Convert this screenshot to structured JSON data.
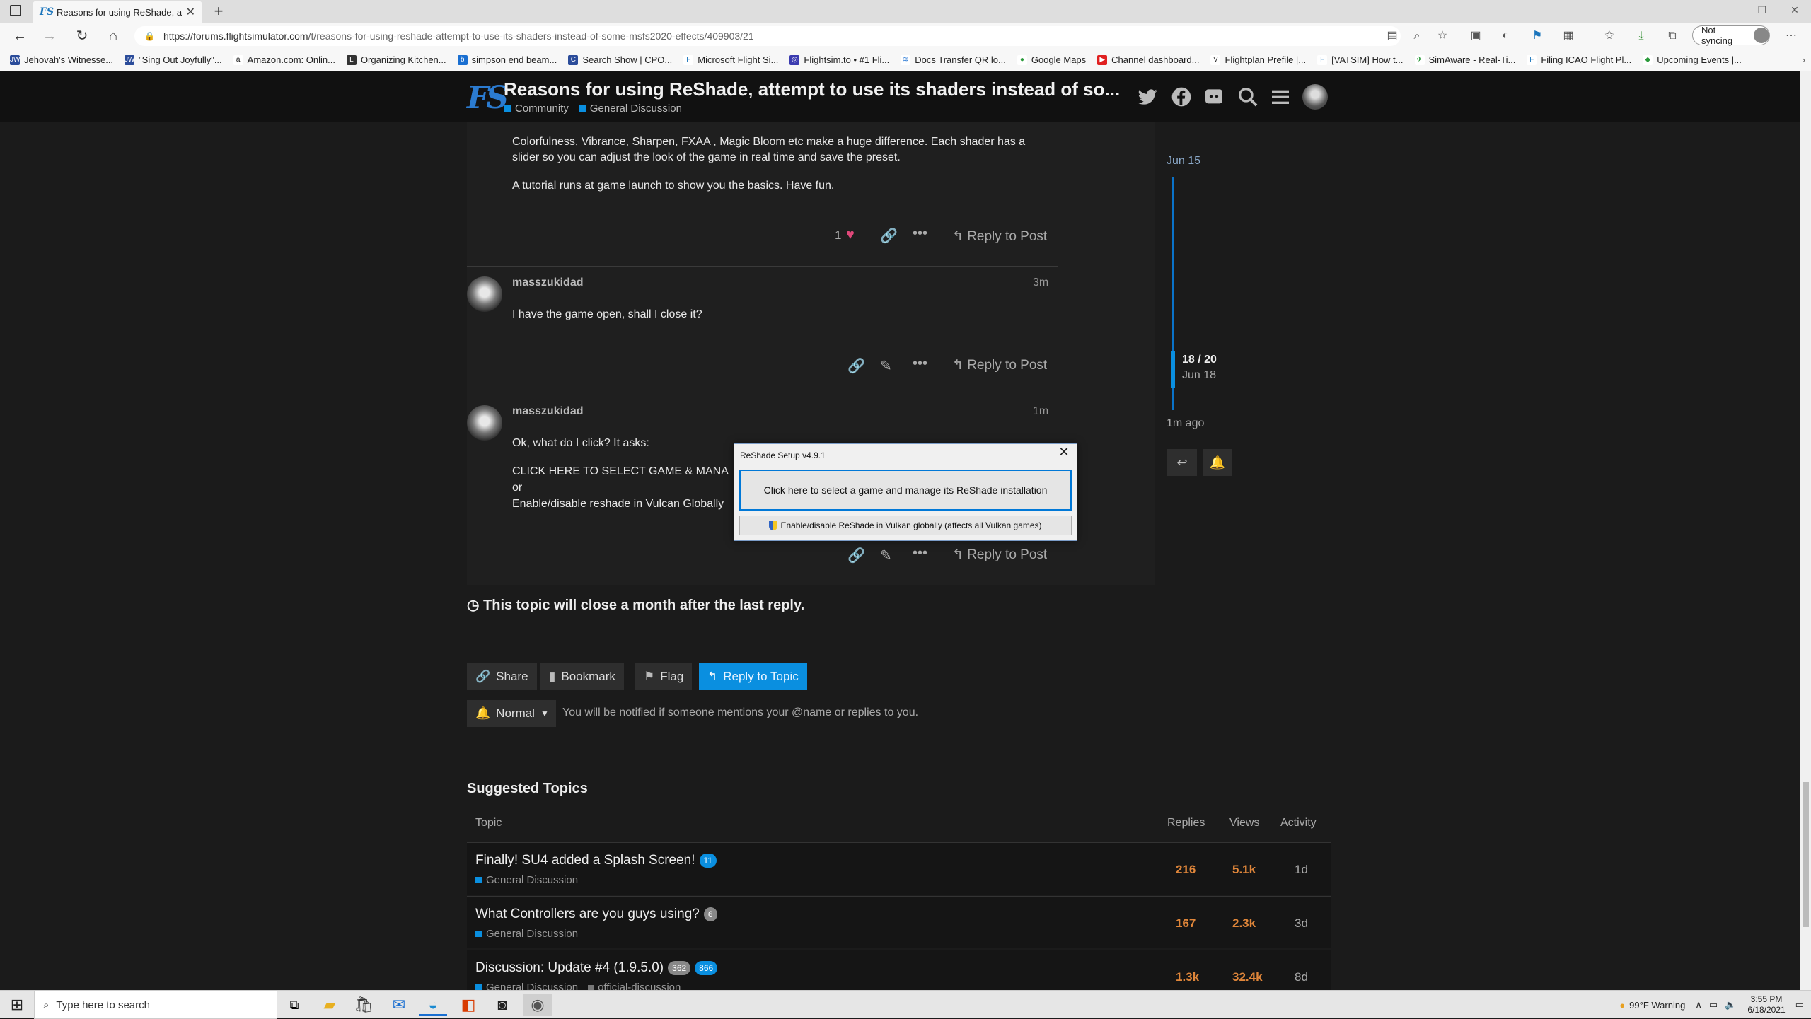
{
  "browser": {
    "tab_title": "Reasons for using ReShade, atte",
    "url_host": "https://forums.flightsimulator.com",
    "url_path": "/t/reasons-for-using-reshade-attempt-to-use-its-shaders-instead-of-some-msfs2020-effects/409903/21",
    "not_syncing": "Not syncing",
    "bookmarks": [
      "Jehovah's Witnesse...",
      "\"Sing Out Joyfully\"...",
      "Amazon.com: Onlin...",
      "Organizing Kitchen...",
      "simpson end beam...",
      "Search Show | CPO...",
      "Microsoft Flight Si...",
      "Flightsim.to • #1 Fli...",
      "Docs Transfer QR lo...",
      "Google Maps",
      "Channel dashboard...",
      "Flightplan Prefile |...",
      "[VATSIM] How t...",
      "SimAware - Real-Ti...",
      "Filing ICAO Flight Pl...",
      "Upcoming Events |..."
    ]
  },
  "forum": {
    "title": "Reasons for using ReShade, attempt to use its shaders instead of so...",
    "cat1": "Community",
    "cat2": "General Discussion"
  },
  "posts": [
    {
      "text1": "Colorfulness, Vibrance, Sharpen, FXAA , Magic Bloom etc make a huge difference. Each shader has a",
      "text2": "slider so you can adjust the look of the game in real time and save the preset.",
      "text3": "A tutorial runs at game launch to show you the basics. Have fun.",
      "likes": "1",
      "reply": "Reply to Post"
    },
    {
      "user": "masszukidad",
      "time": "3m",
      "text": "I have the game open, shall I close it?",
      "reply": "Reply to Post"
    },
    {
      "user": "masszukidad",
      "time": "1m",
      "text1": "Ok, what do I click? It asks:",
      "text2": "CLICK HERE TO SELECT GAME & MANA",
      "text3": "or",
      "text4": "Enable/disable reshade in Vulcan Globally",
      "reply": "Reply to Post"
    }
  ],
  "timeline": {
    "date_top": "Jun 15",
    "position": "18 / 20",
    "date_pos": "Jun 18",
    "ago": "1m ago"
  },
  "dialog": {
    "title": "ReShade Setup v4.9.1",
    "btn1": "Click here to select a game and manage its ReShade installation",
    "btn2": "Enable/disable ReShade in Vulkan globally (affects all Vulkan games)"
  },
  "footer": {
    "close_notice": "This topic will close a month after the last reply.",
    "share": "Share",
    "bookmark": "Bookmark",
    "flag": "Flag",
    "reply_topic": "Reply to Topic",
    "notify_level": "Normal",
    "notify_text": "You will be notified if someone mentions your @name or replies to you."
  },
  "suggested": {
    "title": "Suggested Topics",
    "headers": {
      "topic": "Topic",
      "replies": "Replies",
      "views": "Views",
      "activity": "Activity"
    },
    "rows": [
      {
        "title": "Finally! SU4 added a Splash Screen!",
        "badge": "11",
        "cat": "General Discussion",
        "replies": "216",
        "views": "5.1k",
        "activity": "1d"
      },
      {
        "title": "What Controllers are you guys using?",
        "badge": "6",
        "cat": "General Discussion",
        "replies": "167",
        "views": "2.3k",
        "activity": "3d"
      },
      {
        "title": "Discussion: Update #4 (1.9.5.0)",
        "badge": "362",
        "badge2": "866",
        "cat": "General Discussion",
        "tag": "official-discussion",
        "replies": "1.3k",
        "views": "32.4k",
        "activity": "8d"
      }
    ]
  },
  "taskbar": {
    "search": "Type here to search",
    "weather": "99°F  Warning",
    "time": "3:55 PM",
    "date": "6/18/2021"
  }
}
